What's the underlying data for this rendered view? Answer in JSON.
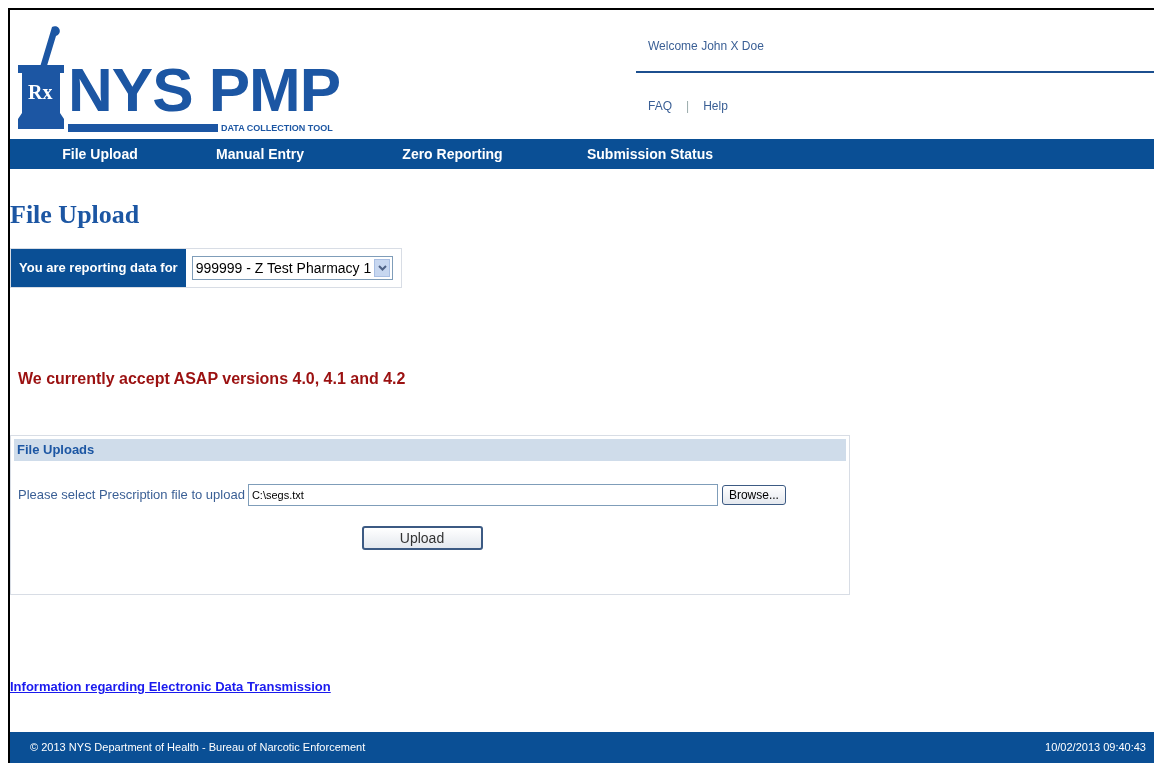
{
  "logo": {
    "mark": "Rx",
    "title": "NYS PMP",
    "subtitle": "DATA COLLECTION TOOL"
  },
  "welcome": "Welcome John X Doe",
  "top_links": [
    {
      "label": "FAQ"
    },
    {
      "label": "Help"
    }
  ],
  "top_link_separator": "|",
  "nav": [
    {
      "label": "File Upload"
    },
    {
      "label": "Manual Entry"
    },
    {
      "label": "Zero Reporting"
    },
    {
      "label": "Submission Status"
    }
  ],
  "page_title": "File Upload",
  "reporting": {
    "label": "You are reporting data for",
    "value": "999999 - Z Test Pharmacy 1"
  },
  "notice": "We currently accept ASAP versions 4.0, 4.1 and 4.2",
  "uploads": {
    "heading": "File Uploads",
    "field_label": "Please select Prescription file to upload",
    "file_value": "C:\\segs.txt",
    "browse": "Browse...",
    "upload": "Upload"
  },
  "info_link": "Information regarding Electronic Data Transmission",
  "footer": {
    "copyright": "© 2013 NYS Department of Health - Bureau of Narcotic Enforcement",
    "timestamp": "10/02/2013 09:40:43"
  }
}
